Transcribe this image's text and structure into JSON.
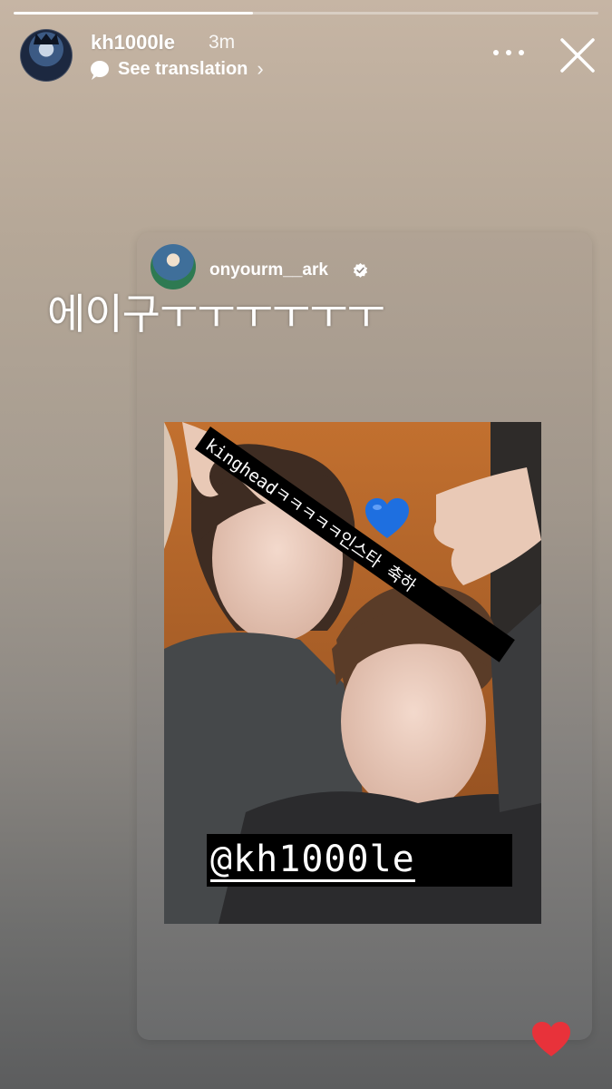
{
  "story": {
    "progress": 0.41,
    "header": {
      "username": "kh1000le",
      "time_ago": "3m",
      "translation_label": "See translation"
    },
    "overlay_text": "에이구ㅜㅜㅜㅜㅜㅜ",
    "shared_post": {
      "username": "onyourm__ark",
      "verified": true,
      "sticker_text": "kingheadㅋㅋㅋㅋㅋ인스타 축하",
      "mention": "@kh1000le"
    },
    "icons": {
      "more": "more-options-icon",
      "close": "close-icon",
      "like": "heart-icon",
      "emoji": "blue-heart-emoji"
    },
    "colors": {
      "like": "#e8323a",
      "emoji": "#1e6fe0"
    }
  }
}
